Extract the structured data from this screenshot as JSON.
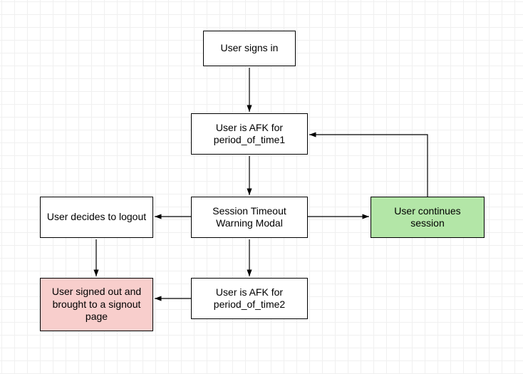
{
  "nodes": {
    "signin": "User signs in",
    "afk1": "User is AFK for period_of_time1",
    "modal": "Session Timeout Warning Modal",
    "logout": "User decides to logout",
    "continues": "User continues session",
    "afk2": "User is AFK for period_of_time2",
    "signedout": "User signed out and brought to a signout page"
  },
  "colors": {
    "green": "#b3e6a7",
    "pink": "#f8cecc"
  },
  "edges": [
    [
      "signin",
      "afk1"
    ],
    [
      "afk1",
      "modal"
    ],
    [
      "modal",
      "logout"
    ],
    [
      "modal",
      "continues"
    ],
    [
      "modal",
      "afk2"
    ],
    [
      "continues",
      "afk1"
    ],
    [
      "logout",
      "signedout"
    ],
    [
      "afk2",
      "signedout"
    ]
  ]
}
